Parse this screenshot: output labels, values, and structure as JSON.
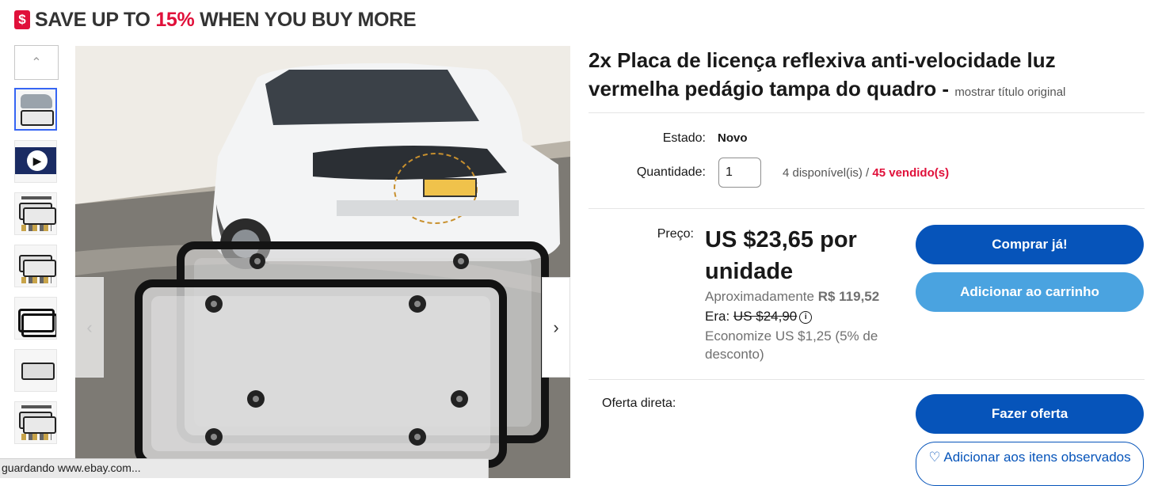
{
  "promo": {
    "icon": "price-tag-icon",
    "prefix": "SAVE UP TO ",
    "highlight": "15%",
    "suffix": " WHEN YOU BUY MORE",
    "highlight_color": "#e0103a"
  },
  "gallery": {
    "up_arrow": "chevron-up-icon",
    "prev_arrow": "chevron-left-icon",
    "next_arrow": "chevron-right-icon",
    "thumbnails": [
      {
        "kind": "car-photo",
        "active": true
      },
      {
        "kind": "video",
        "active": false
      },
      {
        "kind": "plates-pack",
        "active": false
      },
      {
        "kind": "plates-parts",
        "active": false
      },
      {
        "kind": "frames",
        "active": false
      },
      {
        "kind": "single-plate",
        "active": false
      },
      {
        "kind": "plates-pack",
        "active": false
      }
    ],
    "accent_color": "#3665f3"
  },
  "listing": {
    "title": "2x Placa de licença reflexiva anti-velocidade luz vermelha pedágio tampa do quadro -",
    "original_title_link": "mostrar título original",
    "condition_label": "Estado:",
    "condition_value": "Novo",
    "quantity_label": "Quantidade:",
    "quantity_value": "1",
    "available_text": "4 disponível(is) /",
    "sold_text": "45 vendido(s)",
    "price_label": "Preço:",
    "price": "US $23,65 por unidade",
    "approx_prefix": "Aproximadamente",
    "approx_value": "R$ 119,52",
    "was_label": "Era:",
    "was_value": "US $24,90",
    "savings": "Economize US $1,25 (5% de desconto)",
    "offer_label": "Oferta direta:",
    "buy_now": "Comprar já!",
    "add_to_cart": "Adicionar ao carrinho",
    "make_offer": "Fazer oferta",
    "watch": "♡ Adicionar aos itens observados",
    "primary_color": "#0654ba",
    "secondary_color": "#4aa3e0"
  },
  "status_bar": {
    "text": "guardando www.ebay.com..."
  }
}
